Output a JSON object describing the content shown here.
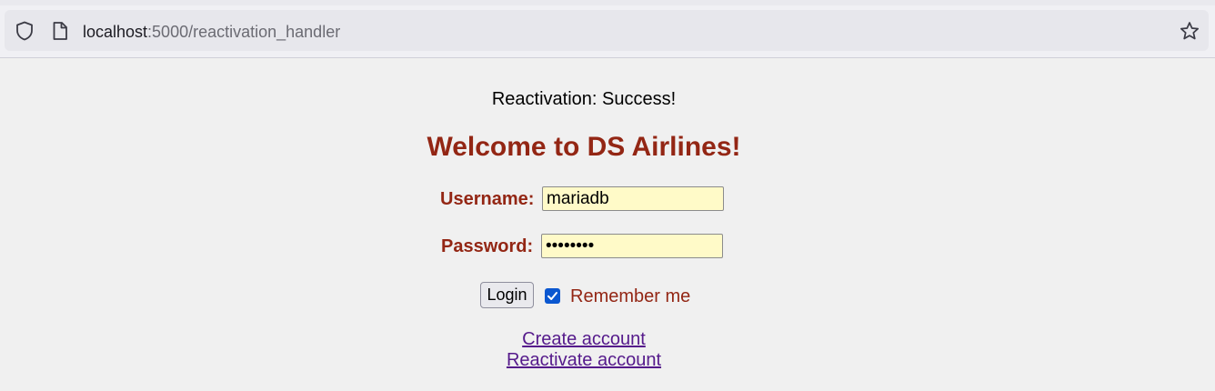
{
  "browser": {
    "url_host": "localhost",
    "url_rest": ":5000/reactivation_handler"
  },
  "page": {
    "status_message": "Reactivation: Success!",
    "heading": "Welcome to DS Airlines!",
    "username_label": "Username:",
    "username_value": "mariadb",
    "password_label": "Password:",
    "password_value": "••••••••",
    "login_button": "Login",
    "remember_label": "Remember me",
    "remember_checked": true,
    "create_account_link": "Create account",
    "reactivate_account_link": "Reactivate account"
  },
  "colors": {
    "accent": "#932614",
    "input_bg": "#fffac8",
    "link": "#551a8b",
    "checkbox": "#0b57d0"
  },
  "icons": {
    "shield": "shield-icon",
    "page": "page-icon",
    "star": "bookmark-star-icon"
  }
}
